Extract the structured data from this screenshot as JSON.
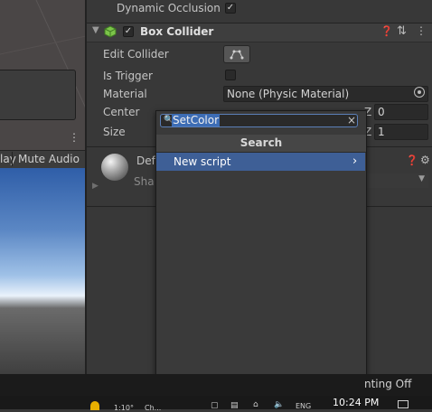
{
  "scene": {},
  "game_bar": {
    "display_tab": "lay",
    "mute_audio": "Mute Audio"
  },
  "inspector": {
    "dynamic_occlusion": {
      "label": "Dynamic Occlusion",
      "checked": "✓"
    },
    "box_collider": {
      "title": "Box Collider",
      "enabled": "✓"
    },
    "edit_collider": {
      "label": "Edit Collider"
    },
    "is_trigger": {
      "label": "Is Trigger"
    },
    "material": {
      "label": "Material",
      "value": "None (Physic Material)"
    },
    "center": {
      "label": "Center",
      "z_label": "Z",
      "z_value": "0"
    },
    "size": {
      "label": "Size",
      "z_label": "Z",
      "z_value": "1"
    },
    "material_section": {
      "name_partial": "Def",
      "shader_partial": "Sha"
    }
  },
  "popup": {
    "search_value": "SetColor",
    "header": "Search",
    "items": [
      {
        "label": "New script",
        "arrow": "›"
      }
    ]
  },
  "status": {
    "lighting": "nting Off"
  },
  "taskbar": {
    "time": "10:24 PM",
    "lang": "ENG",
    "frag_a": "1:10°",
    "frag_b": "Ch..."
  }
}
